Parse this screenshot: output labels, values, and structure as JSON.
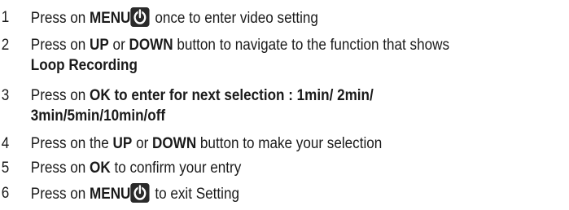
{
  "steps": [
    {
      "number": "1",
      "parts": [
        "Press on ",
        "MENU",
        " once to enter video setting"
      ],
      "icon": "power-icon"
    },
    {
      "number": "2",
      "parts": [
        "Press on ",
        "UP",
        " or ",
        "DOWN",
        " button to navigate to the function that shows"
      ],
      "line2": "Loop Recording"
    },
    {
      "number": "3",
      "parts": [
        "Press on ",
        "OK to enter for next selection : 1min/ 2min/"
      ],
      "line2": "3min/5min/10min/off"
    },
    {
      "number": "4",
      "parts": [
        "Press on the ",
        "UP",
        " or ",
        "DOWN",
        " button to make your selection"
      ]
    },
    {
      "number": "5",
      "parts": [
        "Press on ",
        "OK",
        " to confirm your entry"
      ]
    },
    {
      "number": "6",
      "parts": [
        "Press on ",
        "MENU",
        " to exit Setting"
      ],
      "icon": "power-icon"
    }
  ]
}
